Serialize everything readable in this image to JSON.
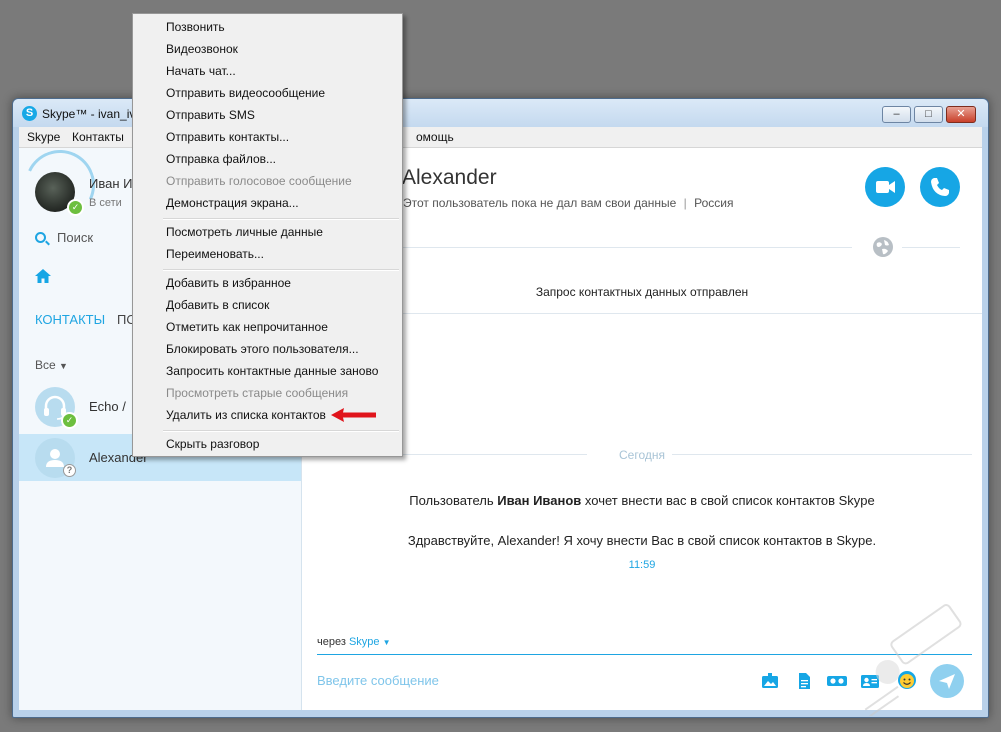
{
  "window": {
    "title": "Skype™ - ivan_iva",
    "controls": {
      "minimize": "–",
      "maximize": "□",
      "close": "✕"
    }
  },
  "menubar": {
    "skype": "Skype",
    "contacts": "Контакты",
    "help_partial": "омощь"
  },
  "profile": {
    "name": "Иван И",
    "status": "В сети"
  },
  "search": {
    "placeholder": "Поиск"
  },
  "tabs": {
    "contacts": "КОНТАКТЫ",
    "recent_partial": "ПО"
  },
  "filter": {
    "label": "Все"
  },
  "contacts": [
    {
      "name": "Echo /"
    },
    {
      "name": "Alexander"
    }
  ],
  "conversation": {
    "contact_name": "Alexander",
    "contact_subtitle": "Этот пользователь пока не дал вам свои данные",
    "contact_country": "Россия",
    "separator": "|",
    "request_note": "Запрос контактных данных отправлен",
    "date_separator": "Сегодня",
    "system_message": {
      "prefix": "Пользователь ",
      "name": "Иван Иванов",
      "suffix": " хочет внести вас в свой список контактов Skype"
    },
    "greeting": "Здравствуйте, Alexander! Я хочу внести Вас в свой список контактов в Skype.",
    "time": "11:59",
    "via_label": "через",
    "via_service": "Skype"
  },
  "compose": {
    "placeholder": "Введите сообщение"
  },
  "context_menu": {
    "groups": [
      [
        {
          "label": "Позвонить",
          "disabled": false
        },
        {
          "label": "Видеозвонок",
          "disabled": false
        },
        {
          "label": "Начать чат...",
          "disabled": false
        },
        {
          "label": "Отправить видеосообщение",
          "disabled": false
        },
        {
          "label": "Отправить SMS",
          "disabled": false
        },
        {
          "label": "Отправить контакты...",
          "disabled": false
        },
        {
          "label": "Отправка файлов...",
          "disabled": false
        },
        {
          "label": "Отправить голосовое сообщение",
          "disabled": true
        },
        {
          "label": "Демонстрация экрана...",
          "disabled": false
        }
      ],
      [
        {
          "label": "Посмотреть личные данные",
          "disabled": false
        },
        {
          "label": "Переименовать...",
          "disabled": false
        }
      ],
      [
        {
          "label": "Добавить в избранное",
          "disabled": false
        },
        {
          "label": "Добавить в список",
          "disabled": false
        },
        {
          "label": "Отметить как непрочитанное",
          "disabled": false
        },
        {
          "label": "Блокировать этого пользователя...",
          "disabled": false
        },
        {
          "label": "Запросить контактные данные заново",
          "disabled": false
        },
        {
          "label": "Просмотреть старые сообщения",
          "disabled": true
        },
        {
          "label": "Удалить из списка контактов",
          "disabled": false
        }
      ],
      [
        {
          "label": "Скрыть разговор",
          "disabled": false
        }
      ]
    ]
  },
  "colors": {
    "accent": "#16a6e5",
    "online": "#6dbf3f",
    "selected_row": "#c7e6f8",
    "arrow": "#e0141b"
  },
  "icons": {
    "title": "skype-logo-icon",
    "search": "search-icon",
    "home": "home-icon",
    "video_call": "video-camera-icon",
    "call": "phone-icon",
    "globe": "globe-icon",
    "send": "send-icon"
  }
}
